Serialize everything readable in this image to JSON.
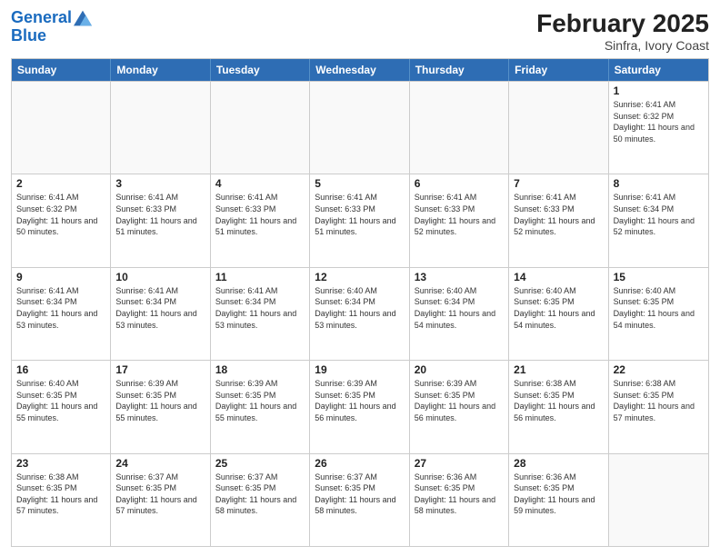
{
  "header": {
    "logo_line1": "General",
    "logo_line2": "Blue",
    "title": "February 2025",
    "subtitle": "Sinfra, Ivory Coast"
  },
  "weekdays": [
    "Sunday",
    "Monday",
    "Tuesday",
    "Wednesday",
    "Thursday",
    "Friday",
    "Saturday"
  ],
  "weeks": [
    [
      {
        "day": "",
        "empty": true
      },
      {
        "day": "",
        "empty": true
      },
      {
        "day": "",
        "empty": true
      },
      {
        "day": "",
        "empty": true
      },
      {
        "day": "",
        "empty": true
      },
      {
        "day": "",
        "empty": true
      },
      {
        "day": "1",
        "sunrise": "6:41 AM",
        "sunset": "6:32 PM",
        "daylight": "11 hours and 50 minutes."
      }
    ],
    [
      {
        "day": "2",
        "sunrise": "6:41 AM",
        "sunset": "6:32 PM",
        "daylight": "11 hours and 50 minutes."
      },
      {
        "day": "3",
        "sunrise": "6:41 AM",
        "sunset": "6:33 PM",
        "daylight": "11 hours and 51 minutes."
      },
      {
        "day": "4",
        "sunrise": "6:41 AM",
        "sunset": "6:33 PM",
        "daylight": "11 hours and 51 minutes."
      },
      {
        "day": "5",
        "sunrise": "6:41 AM",
        "sunset": "6:33 PM",
        "daylight": "11 hours and 51 minutes."
      },
      {
        "day": "6",
        "sunrise": "6:41 AM",
        "sunset": "6:33 PM",
        "daylight": "11 hours and 52 minutes."
      },
      {
        "day": "7",
        "sunrise": "6:41 AM",
        "sunset": "6:33 PM",
        "daylight": "11 hours and 52 minutes."
      },
      {
        "day": "8",
        "sunrise": "6:41 AM",
        "sunset": "6:34 PM",
        "daylight": "11 hours and 52 minutes."
      }
    ],
    [
      {
        "day": "9",
        "sunrise": "6:41 AM",
        "sunset": "6:34 PM",
        "daylight": "11 hours and 53 minutes."
      },
      {
        "day": "10",
        "sunrise": "6:41 AM",
        "sunset": "6:34 PM",
        "daylight": "11 hours and 53 minutes."
      },
      {
        "day": "11",
        "sunrise": "6:41 AM",
        "sunset": "6:34 PM",
        "daylight": "11 hours and 53 minutes."
      },
      {
        "day": "12",
        "sunrise": "6:40 AM",
        "sunset": "6:34 PM",
        "daylight": "11 hours and 53 minutes."
      },
      {
        "day": "13",
        "sunrise": "6:40 AM",
        "sunset": "6:34 PM",
        "daylight": "11 hours and 54 minutes."
      },
      {
        "day": "14",
        "sunrise": "6:40 AM",
        "sunset": "6:35 PM",
        "daylight": "11 hours and 54 minutes."
      },
      {
        "day": "15",
        "sunrise": "6:40 AM",
        "sunset": "6:35 PM",
        "daylight": "11 hours and 54 minutes."
      }
    ],
    [
      {
        "day": "16",
        "sunrise": "6:40 AM",
        "sunset": "6:35 PM",
        "daylight": "11 hours and 55 minutes."
      },
      {
        "day": "17",
        "sunrise": "6:39 AM",
        "sunset": "6:35 PM",
        "daylight": "11 hours and 55 minutes."
      },
      {
        "day": "18",
        "sunrise": "6:39 AM",
        "sunset": "6:35 PM",
        "daylight": "11 hours and 55 minutes."
      },
      {
        "day": "19",
        "sunrise": "6:39 AM",
        "sunset": "6:35 PM",
        "daylight": "11 hours and 56 minutes."
      },
      {
        "day": "20",
        "sunrise": "6:39 AM",
        "sunset": "6:35 PM",
        "daylight": "11 hours and 56 minutes."
      },
      {
        "day": "21",
        "sunrise": "6:38 AM",
        "sunset": "6:35 PM",
        "daylight": "11 hours and 56 minutes."
      },
      {
        "day": "22",
        "sunrise": "6:38 AM",
        "sunset": "6:35 PM",
        "daylight": "11 hours and 57 minutes."
      }
    ],
    [
      {
        "day": "23",
        "sunrise": "6:38 AM",
        "sunset": "6:35 PM",
        "daylight": "11 hours and 57 minutes."
      },
      {
        "day": "24",
        "sunrise": "6:37 AM",
        "sunset": "6:35 PM",
        "daylight": "11 hours and 57 minutes."
      },
      {
        "day": "25",
        "sunrise": "6:37 AM",
        "sunset": "6:35 PM",
        "daylight": "11 hours and 58 minutes."
      },
      {
        "day": "26",
        "sunrise": "6:37 AM",
        "sunset": "6:35 PM",
        "daylight": "11 hours and 58 minutes."
      },
      {
        "day": "27",
        "sunrise": "6:36 AM",
        "sunset": "6:35 PM",
        "daylight": "11 hours and 58 minutes."
      },
      {
        "day": "28",
        "sunrise": "6:36 AM",
        "sunset": "6:35 PM",
        "daylight": "11 hours and 59 minutes."
      },
      {
        "day": "",
        "empty": true
      }
    ]
  ]
}
